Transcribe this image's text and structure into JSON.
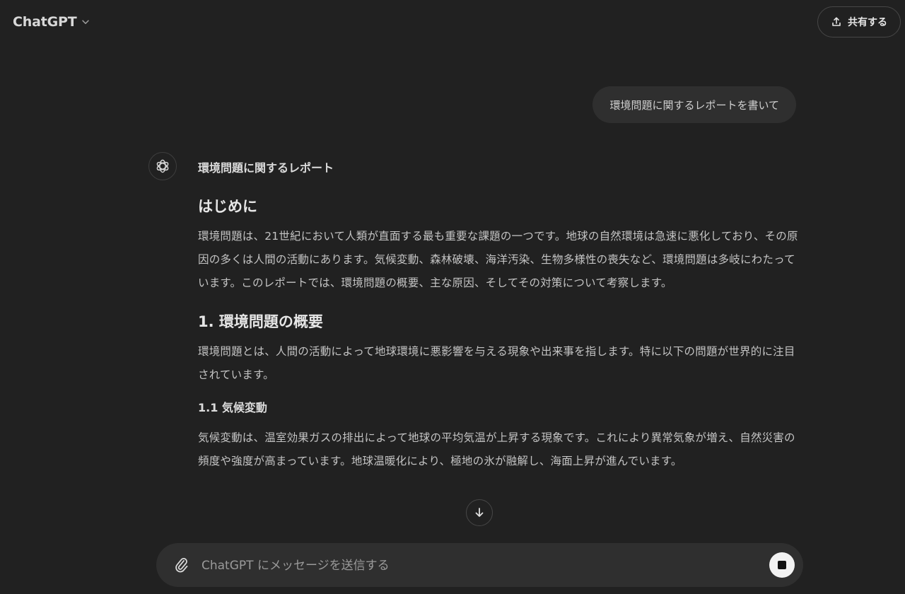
{
  "header": {
    "model_name": "ChatGPT",
    "share_label": "共有する"
  },
  "conversation": {
    "user_message": "環境問題に関するレポートを書いて",
    "assistant": {
      "title": "環境問題に関するレポート",
      "sections": {
        "intro_heading": "はじめに",
        "intro_para": "環境問題は、21世紀において人類が直面する最も重要な課題の一つです。地球の自然環境は急速に悪化しており、その原因の多くは人間の活動にあります。気候変動、森林破壊、海洋汚染、生物多様性の喪失など、環境問題は多岐にわたっています。このレポートでは、環境問題の概要、主な原因、そしてその対策について考察します。",
        "overview_heading": "1. 環境問題の概要",
        "overview_para": "環境問題とは、人間の活動によって地球環境に悪影響を与える現象や出来事を指します。特に以下の問題が世界的に注目されています。",
        "climate_heading": "1.1 気候変動",
        "climate_para": "気候変動は、温室効果ガスの排出によって地球の平均気温が上昇する現象です。これにより異常気象が増え、自然災害の頻度や強度が高まっています。地球温暖化により、極地の氷が融解し、海面上昇が進んでいます。"
      }
    }
  },
  "composer": {
    "placeholder": "ChatGPT にメッセージを送信する"
  },
  "icons": {
    "model_dropdown": "chevron-down-icon",
    "share": "upload-icon",
    "avatar": "openai-logo-icon",
    "scroll": "arrow-down-icon",
    "attach": "paperclip-icon",
    "stop": "stop-icon"
  },
  "colors": {
    "background": "#212121",
    "bubble": "#2f2f2f",
    "stop_button": "#f2f2f2"
  }
}
